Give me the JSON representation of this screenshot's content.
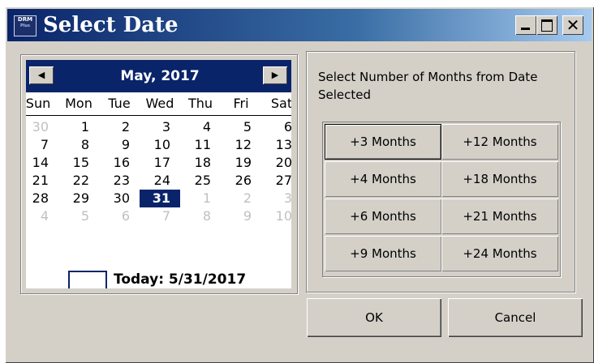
{
  "window": {
    "title": "Select Date",
    "icon_text_top": "DRM",
    "icon_text_bottom": "Plus"
  },
  "calendar": {
    "month_year": "May, 2017",
    "prev_glyph": "◀",
    "next_glyph": "▶",
    "weekdays": [
      "Sun",
      "Mon",
      "Tue",
      "Wed",
      "Thu",
      "Fri",
      "Sat"
    ],
    "weeks": [
      [
        "30",
        "1",
        "2",
        "3",
        "4",
        "5",
        "6"
      ],
      [
        "7",
        "8",
        "9",
        "10",
        "11",
        "12",
        "13"
      ],
      [
        "14",
        "15",
        "16",
        "17",
        "18",
        "19",
        "20"
      ],
      [
        "21",
        "22",
        "23",
        "24",
        "25",
        "26",
        "27"
      ],
      [
        "28",
        "29",
        "30",
        "31",
        "1",
        "2",
        "3"
      ],
      [
        "4",
        "5",
        "6",
        "7",
        "8",
        "9",
        "10"
      ]
    ],
    "selected_date": "31",
    "today_label": "Today: 5/31/2017"
  },
  "months_group": {
    "label": "Select Number of Months from Date Selected",
    "buttons": [
      "+3 Months",
      "+12 Months",
      "+4 Months",
      "+18 Months",
      "+6 Months",
      "+21 Months",
      "+9 Months",
      "+24 Months"
    ]
  },
  "actions": {
    "ok_label": "OK",
    "cancel_label": "Cancel"
  },
  "colors": {
    "title_bar": "#0a246a",
    "selection": "#0a246a",
    "face": "#d4d0c8"
  }
}
